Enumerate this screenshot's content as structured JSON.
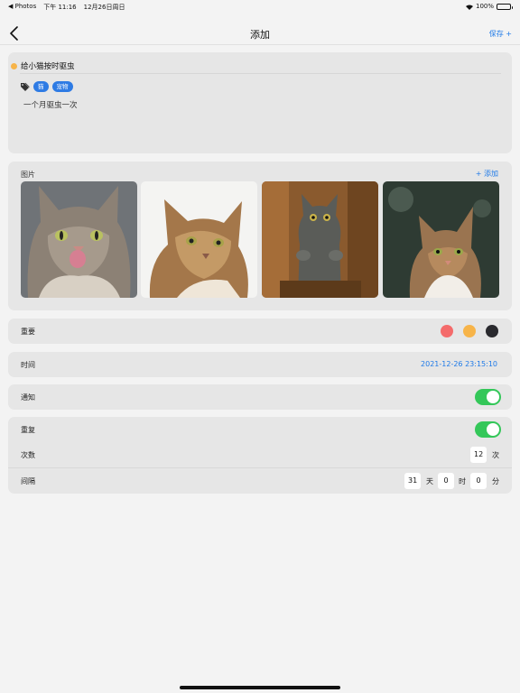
{
  "status": {
    "back_app": "◀ Photos",
    "time": "下午 11:16",
    "date": "12月26日周日",
    "battery": "100%"
  },
  "nav": {
    "title": "添加",
    "save": "保存 +"
  },
  "todo": {
    "title": "给小猫按时驱虫",
    "dot_color": "#f7b449",
    "tags": [
      "猫",
      "宠物"
    ],
    "note": "一个月驱虫一次"
  },
  "photos": {
    "label": "图片",
    "add": "+ 添加"
  },
  "importance": {
    "label": "重要",
    "colors": [
      "#f46b6b",
      "#f7b449",
      "#2a2a2e"
    ]
  },
  "time_row": {
    "label": "时间",
    "value": "2021-12-26 23:15:10"
  },
  "notify": {
    "label": "通知",
    "on": true
  },
  "repeat": {
    "label": "重复",
    "on": true,
    "count_label": "次数",
    "count_value": "12",
    "count_unit": "次",
    "interval_label": "间隔",
    "days": "31",
    "days_unit": "天",
    "hours": "0",
    "hours_unit": "时",
    "minutes": "0",
    "minutes_unit": "分"
  }
}
